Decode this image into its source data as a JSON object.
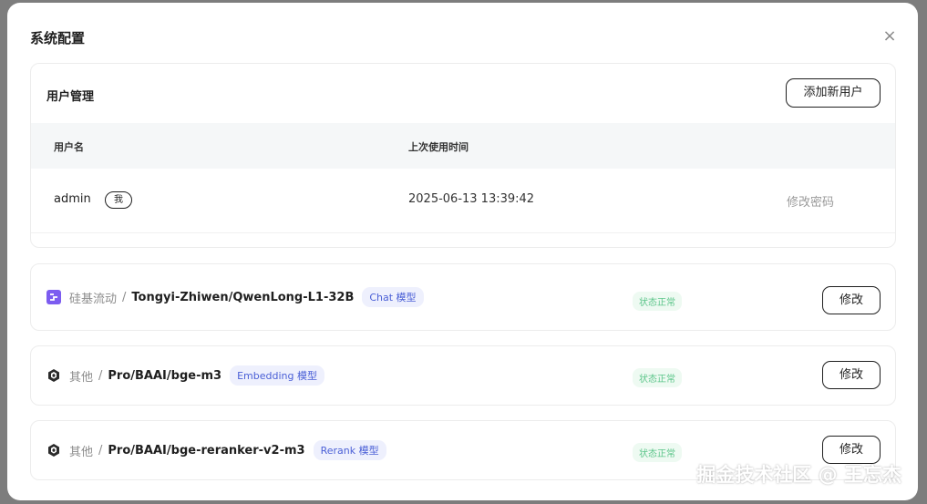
{
  "dialog": {
    "title": "系统配置",
    "close_symbol": "×"
  },
  "user_management": {
    "title": "用户管理",
    "add_user_label": "添加新用户",
    "columns": {
      "username": "用户名",
      "last_used": "上次使用时间"
    },
    "rows": [
      {
        "username": "admin",
        "badge": "我",
        "last_used": "2025-06-13 13:39:42",
        "action": "修改密码"
      }
    ]
  },
  "models": [
    {
      "provider": "硅基流动",
      "provider_icon": "siliconflow-icon",
      "separator": "/",
      "name": "Tongyi-Zhiwen/QwenLong-L1-32B",
      "type": "Chat 模型",
      "status": "状态正常",
      "edit_label": "修改"
    },
    {
      "provider": "其他",
      "provider_icon": "cube-icon",
      "separator": "/",
      "name": "Pro/BAAI/bge-m3",
      "type": "Embedding 模型",
      "status": "状态正常",
      "edit_label": "修改"
    },
    {
      "provider": "其他",
      "provider_icon": "cube-icon",
      "separator": "/",
      "name": "Pro/BAAI/bge-reranker-v2-m3",
      "type": "Rerank 模型",
      "status": "状态正常",
      "edit_label": "修改"
    }
  ],
  "watermark": "掘金技术社区 @ 王忘杰",
  "colors": {
    "accent_tag_bg": "#eef0fd",
    "accent_tag_text": "#4a5fd6",
    "status_bg": "#eefaf2",
    "status_text": "#5cc58a",
    "siliconflow_brand": "#7c5cf0"
  }
}
